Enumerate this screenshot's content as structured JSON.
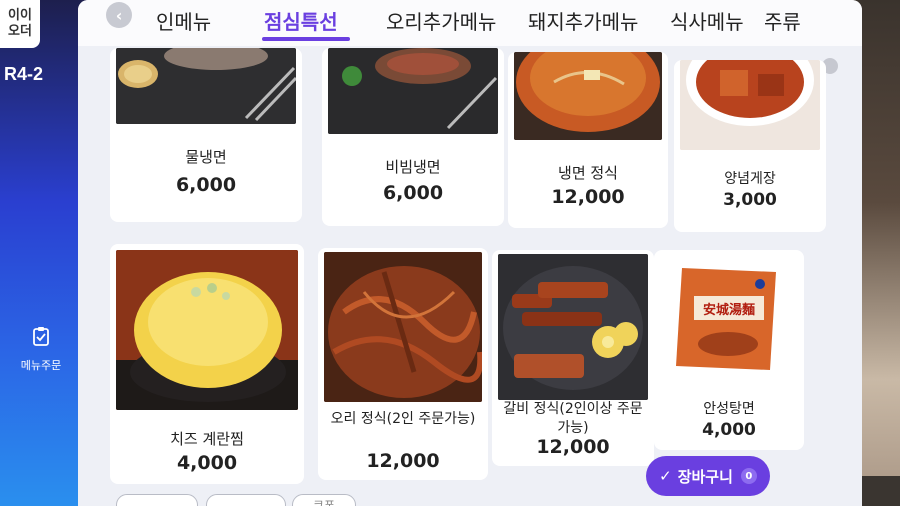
{
  "sidebar": {
    "brand_line1": "이이",
    "brand_line2": "오더",
    "table_number": "R4-2",
    "menu_order_label": "메뉴주문",
    "menu_order_icon": "clipboard-icon"
  },
  "tabs": [
    {
      "label": "인메뉴"
    },
    {
      "label": "점심특선"
    },
    {
      "label": "오리추가메뉴"
    },
    {
      "label": "돼지추가메뉴"
    },
    {
      "label": "식사메뉴"
    },
    {
      "label": "주류"
    }
  ],
  "active_tab": "점심특선",
  "menu_items": [
    {
      "name": "물냉면",
      "price": "6,000"
    },
    {
      "name": "비빔냉면",
      "price": "6,000"
    },
    {
      "name": "냉면 정식",
      "price": "12,000"
    },
    {
      "name": "양념게장",
      "price": "3,000"
    },
    {
      "name": "치즈 계란찜",
      "price": "4,000"
    },
    {
      "name": "오리 정식(2인 주문가능)",
      "price": "12,000"
    },
    {
      "name": "갈비 정식(2인이상 주문가능)",
      "price": "12,000"
    },
    {
      "name": "안성탕면",
      "price": "4,000"
    }
  ],
  "cart": {
    "label": "장바구니",
    "count": "0"
  },
  "bottom_buttons": [
    {
      "label": ""
    },
    {
      "label": "쿠폰"
    }
  ],
  "colors": {
    "accent": "#6a3fe0",
    "card": "#ffffff",
    "screen_bg": "#eef0f6"
  }
}
